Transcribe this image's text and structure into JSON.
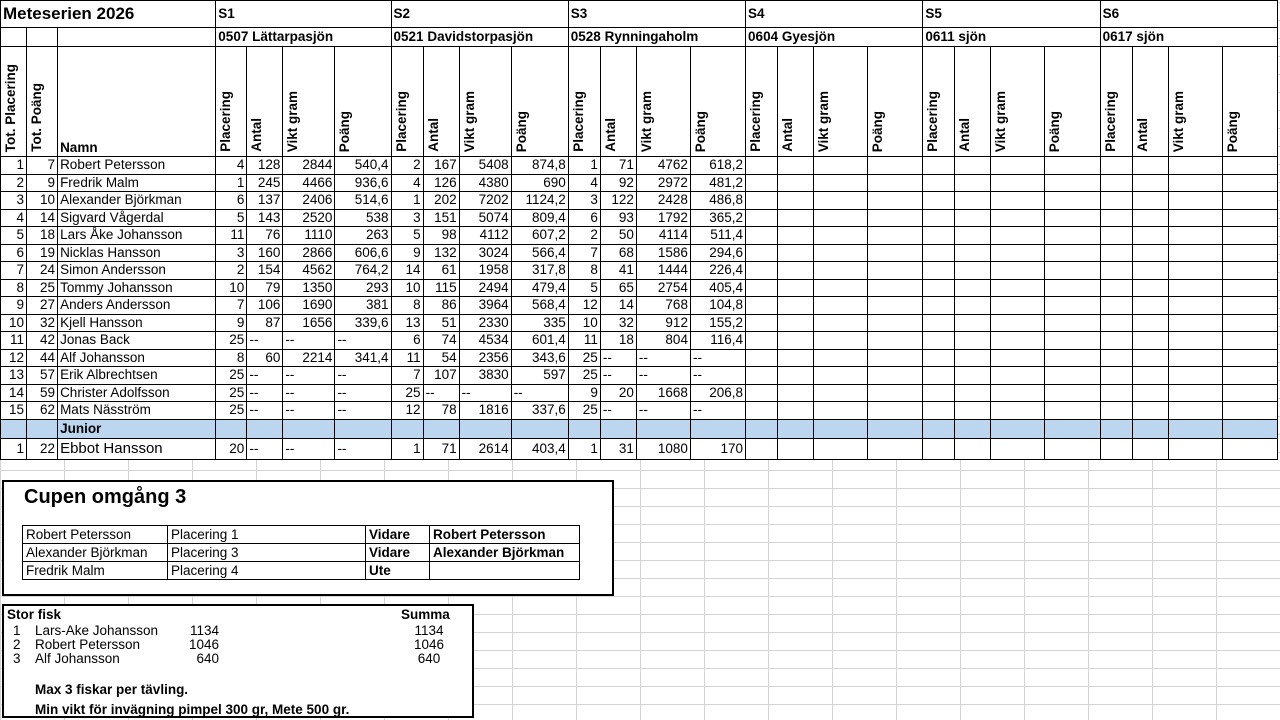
{
  "sheet": {
    "title": "Meteserien 2026",
    "stages": [
      {
        "code": "S1",
        "venue": "0507 Lättarpasjön"
      },
      {
        "code": "S2",
        "venue": "0521 Davidstorpasjön"
      },
      {
        "code": "S3",
        "venue": "0528 Rynningaholm"
      },
      {
        "code": "S4",
        "venue": "0604 Gyesjön"
      },
      {
        "code": "S5",
        "venue": "0611 sjön"
      },
      {
        "code": "S6",
        "venue": "0617 sjön"
      }
    ],
    "headers": {
      "tot_placering": "Tot. Placering",
      "tot_poang": "Tot. Poäng",
      "namn": "Namn",
      "placering": "Placering",
      "antal": "Antal",
      "vikt": "Vikt gram",
      "poang": "Poäng"
    },
    "rows": [
      [
        "1",
        "7",
        "Robert Petersson",
        "4",
        "128",
        "2844",
        "540,4",
        "2",
        "167",
        "5408",
        "874,8",
        "1",
        "71",
        "4762",
        "618,2"
      ],
      [
        "2",
        "9",
        "Fredrik Malm",
        "1",
        "245",
        "4466",
        "936,6",
        "4",
        "126",
        "4380",
        "690",
        "4",
        "92",
        "2972",
        "481,2"
      ],
      [
        "3",
        "10",
        "Alexander Björkman",
        "6",
        "137",
        "2406",
        "514,6",
        "1",
        "202",
        "7202",
        "1124,2",
        "3",
        "122",
        "2428",
        "486,8"
      ],
      [
        "4",
        "14",
        "Sigvard Vågerdal",
        "5",
        "143",
        "2520",
        "538",
        "3",
        "151",
        "5074",
        "809,4",
        "6",
        "93",
        "1792",
        "365,2"
      ],
      [
        "5",
        "18",
        "Lars Åke Johansson",
        "11",
        "76",
        "1110",
        "263",
        "5",
        "98",
        "4112",
        "607,2",
        "2",
        "50",
        "4114",
        "511,4"
      ],
      [
        "6",
        "19",
        "Nicklas Hansson",
        "3",
        "160",
        "2866",
        "606,6",
        "9",
        "132",
        "3024",
        "566,4",
        "7",
        "68",
        "1586",
        "294,6"
      ],
      [
        "7",
        "24",
        "Simon Andersson",
        "2",
        "154",
        "4562",
        "764,2",
        "14",
        "61",
        "1958",
        "317,8",
        "8",
        "41",
        "1444",
        "226,4"
      ],
      [
        "8",
        "25",
        "Tommy Johansson",
        "10",
        "79",
        "1350",
        "293",
        "10",
        "115",
        "2494",
        "479,4",
        "5",
        "65",
        "2754",
        "405,4"
      ],
      [
        "9",
        "27",
        "Anders Andersson",
        "7",
        "106",
        "1690",
        "381",
        "8",
        "86",
        "3964",
        "568,4",
        "12",
        "14",
        "768",
        "104,8"
      ],
      [
        "10",
        "32",
        "Kjell Hansson",
        "9",
        "87",
        "1656",
        "339,6",
        "13",
        "51",
        "2330",
        "335",
        "10",
        "32",
        "912",
        "155,2"
      ],
      [
        "11",
        "42",
        "Jonas Back",
        "25",
        "--",
        "--",
        "--",
        "6",
        "74",
        "4534",
        "601,4",
        "11",
        "18",
        "804",
        "116,4"
      ],
      [
        "12",
        "44",
        "Alf Johansson",
        "8",
        "60",
        "2214",
        "341,4",
        "11",
        "54",
        "2356",
        "343,6",
        "25",
        "--",
        "--",
        "--"
      ],
      [
        "13",
        "57",
        "Erik Albrechtsen",
        "25",
        "--",
        "--",
        "--",
        "7",
        "107",
        "3830",
        "597",
        "25",
        "--",
        "--",
        "--"
      ],
      [
        "14",
        "59",
        "Christer Adolfsson",
        "25",
        "--",
        "--",
        "--",
        "25",
        "--",
        "--",
        "--",
        "9",
        "20",
        "1668",
        "206,8"
      ],
      [
        "15",
        "62",
        "Mats Näsström",
        "25",
        "--",
        "--",
        "--",
        "12",
        "78",
        "1816",
        "337,6",
        "25",
        "--",
        "--",
        "--"
      ]
    ],
    "junior_label": "Junior",
    "junior_rows": [
      [
        "1",
        "22",
        "Ebbot Hansson",
        "20",
        "--",
        "--",
        "--",
        "1",
        "71",
        "2614",
        "403,4",
        "1",
        "31",
        "1080",
        "170"
      ]
    ]
  },
  "cup": {
    "title": "Cupen omgång 3",
    "rows": [
      {
        "name": "Robert Petersson",
        "placement": "Placering 1",
        "status": "Vidare",
        "advancer": "Robert Petersson"
      },
      {
        "name": "Alexander Björkman",
        "placement": "Placering 3",
        "status": "Vidare",
        "advancer": "Alexander Björkman"
      },
      {
        "name": "Fredrik Malm",
        "placement": "Placering 4",
        "status": "Ute",
        "advancer": ""
      }
    ]
  },
  "big_fish": {
    "title": "Stor fisk",
    "summa_label": "Summa",
    "rows": [
      {
        "rank": "1",
        "name": "Lars-Ake Johansson",
        "weight": "1134",
        "summa": "1134"
      },
      {
        "rank": "2",
        "name": "Robert Petersson",
        "weight": "1046",
        "summa": "1046"
      },
      {
        "rank": "3",
        "name": "Alf Johansson",
        "weight": "640",
        "summa": "640"
      }
    ],
    "note1": "Max 3 fiskar per tävling.",
    "note2": "Min vikt för invägning pimpel 300 gr, Mete 500 gr."
  }
}
